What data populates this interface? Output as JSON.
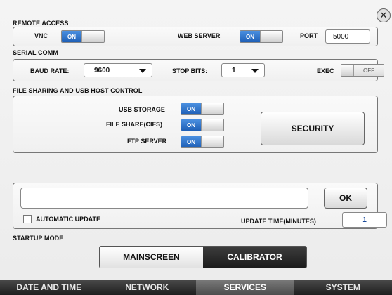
{
  "close": {
    "glyph": "✕"
  },
  "remote_access": {
    "title": "REMOTE ACCESS",
    "vnc_label": "VNC",
    "vnc_state": "ON",
    "web_server_label": "WEB SERVER",
    "web_server_state": "ON",
    "port_label": "PORT",
    "port_value": "5000"
  },
  "serial_comm": {
    "title": "SERIAL COMM",
    "baud_label": "BAUD RATE:",
    "baud_value": "9600",
    "stop_bits_label": "STOP BITS:",
    "stop_bits_value": "1",
    "exec_label": "EXEC",
    "exec_state": "OFF"
  },
  "file_sharing": {
    "title": "FILE SHARING AND USB HOST CONTROL",
    "usb_storage_label": "USB STORAGE",
    "usb_storage_state": "ON",
    "file_share_label": "FILE SHARE(CIFS)",
    "file_share_state": "ON",
    "ftp_server_label": "FTP SERVER",
    "ftp_server_state": "ON",
    "security_button": "SECURITY"
  },
  "update": {
    "input_value": "",
    "ok_button": "OK",
    "automatic_update_label": "AUTOMATIC UPDATE",
    "automatic_update_checked": false,
    "update_time_label": "UPDATE TIME(MINUTES)",
    "update_time_value": "1"
  },
  "startup_mode": {
    "title": "STARTUP MODE",
    "options": [
      "MAINSCREEN",
      "CALIBRATOR"
    ],
    "selected": "CALIBRATOR"
  },
  "tabs": [
    {
      "label": "DATE AND TIME"
    },
    {
      "label": "NETWORK"
    },
    {
      "label": "SERVICES",
      "active": true
    },
    {
      "label": "SYSTEM"
    }
  ]
}
